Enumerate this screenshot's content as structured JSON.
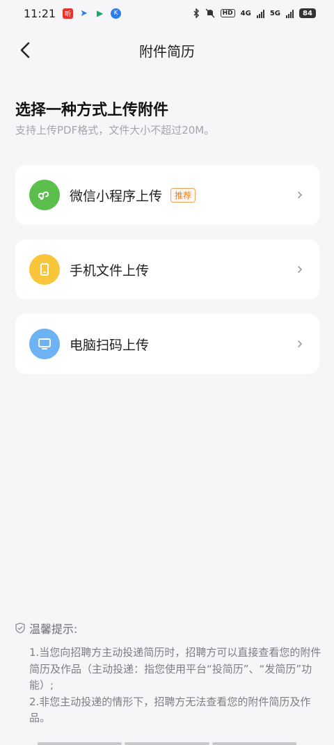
{
  "status_bar": {
    "time": "11:21",
    "app_icons": [
      {
        "name": "news-app-icon",
        "glyph": "听",
        "color": "#e8322c"
      },
      {
        "name": "send-app-icon",
        "glyph": "➤",
        "color": "#2a7de1"
      },
      {
        "name": "play-app-icon",
        "glyph": "▶",
        "color": "#1aa56a"
      },
      {
        "name": "k-app-icon",
        "glyph": "K",
        "color": "#2c7ff0"
      }
    ],
    "hd_label": "HD",
    "net1": "4G",
    "net2": "5G",
    "battery": "84"
  },
  "header": {
    "title": "附件简历"
  },
  "main": {
    "heading": "选择一种方式上传附件",
    "subheading": "支持上传PDF格式，文件大小不超过20M。"
  },
  "options": [
    {
      "label": "微信小程序上传",
      "tag": "推荐",
      "icon": "mini-program-icon",
      "icon_bg": "#5cbe4d"
    },
    {
      "label": "手机文件上传",
      "icon": "phone-icon",
      "icon_bg": "#f9c53a"
    },
    {
      "label": "电脑扫码上传",
      "icon": "computer-icon",
      "icon_bg": "#6db2f2"
    }
  ],
  "tips": {
    "title": "温馨提示:",
    "line1": "1.当您向招聘方主动投递简历时，招聘方可以直接查看您的附件简历及作品（主动投递：指您使用平台“投简历”、“发简历”功能）;",
    "line2": "2.非您主动投递的情形下，招聘方无法查看您的附件简历及作品。"
  }
}
